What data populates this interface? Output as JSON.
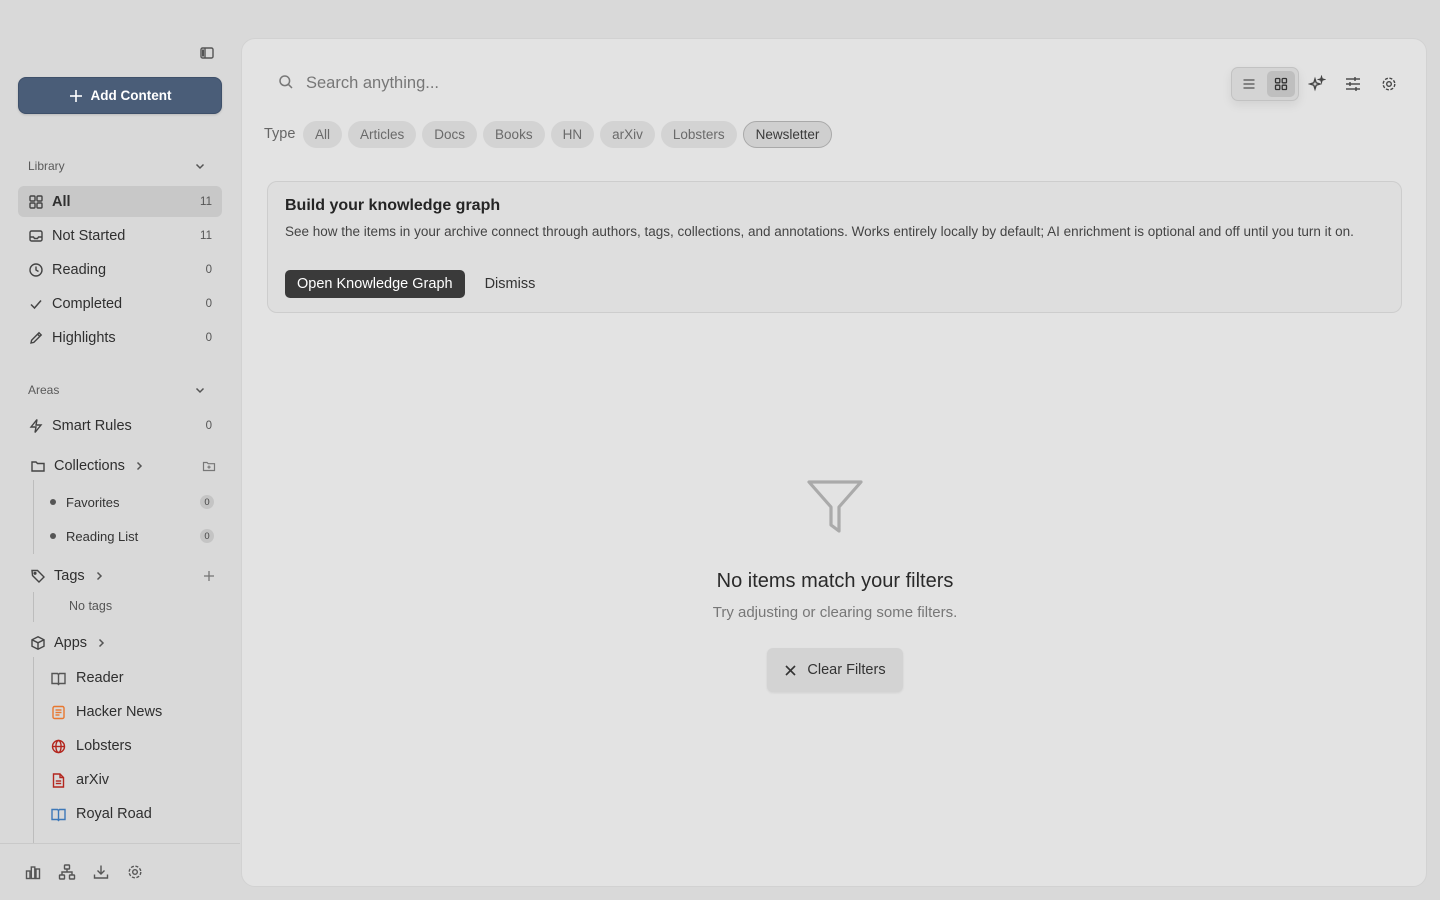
{
  "sidebar": {
    "add_button": "Add Content",
    "library": {
      "heading": "Library",
      "items": [
        {
          "label": "All",
          "count": "11"
        },
        {
          "label": "Not Started",
          "count": "11"
        },
        {
          "label": "Reading",
          "count": "0"
        },
        {
          "label": "Completed",
          "count": "0"
        },
        {
          "label": "Highlights",
          "count": "0"
        }
      ]
    },
    "areas": {
      "heading": "Areas",
      "smart_rules": {
        "label": "Smart Rules",
        "count": "0"
      },
      "collections": {
        "label": "Collections",
        "items": [
          {
            "label": "Favorites",
            "count": "0"
          },
          {
            "label": "Reading List",
            "count": "0"
          }
        ]
      },
      "tags": {
        "label": "Tags",
        "empty": "No tags"
      },
      "apps": {
        "label": "Apps",
        "items": [
          {
            "label": "Reader",
            "icon": "book-icon",
            "color": "#555555"
          },
          {
            "label": "Hacker News",
            "icon": "hacker-news-icon",
            "color": "#e8772e"
          },
          {
            "label": "Lobsters",
            "icon": "globe-icon",
            "color": "#b3261e"
          },
          {
            "label": "arXiv",
            "icon": "document-icon",
            "color": "#b3261e"
          },
          {
            "label": "Royal Road",
            "icon": "book-icon",
            "color": "#3d78b8"
          }
        ]
      }
    }
  },
  "main": {
    "search": {
      "placeholder": "Search anything..."
    },
    "filters": {
      "label": "Type",
      "chips": [
        "All",
        "Articles",
        "Docs",
        "Books",
        "HN",
        "arXiv",
        "Lobsters",
        "Newsletter"
      ],
      "selected": "Newsletter"
    },
    "banner": {
      "title": "Build your knowledge graph",
      "text": "See how the items in your archive connect through authors, tags, collections, and annotations. Works entirely locally by default; AI enrichment is optional and off until you turn it on.",
      "primary": "Open Knowledge Graph",
      "dismiss": "Dismiss"
    },
    "empty": {
      "title": "No items match your filters",
      "subtitle": "Try adjusting or clearing some filters.",
      "button": "Clear Filters"
    }
  }
}
